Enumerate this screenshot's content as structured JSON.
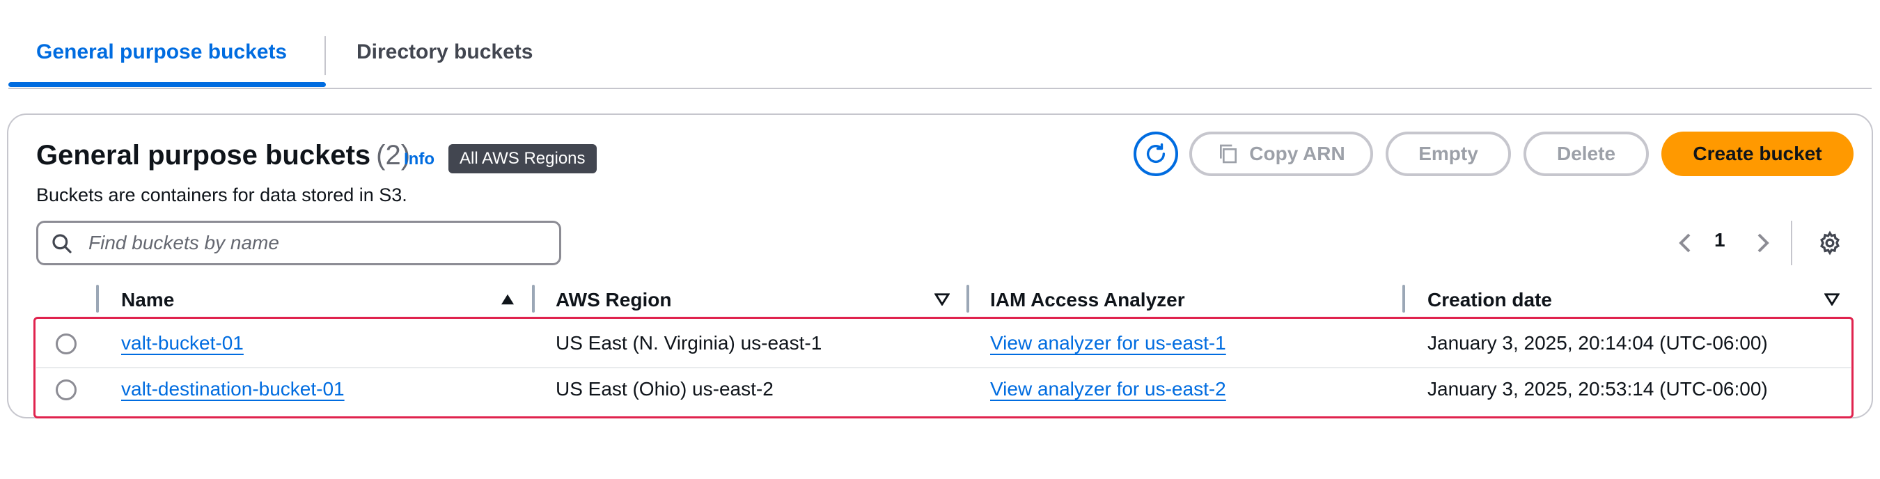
{
  "tabs": [
    {
      "label": "General purpose buckets",
      "active": true
    },
    {
      "label": "Directory buckets",
      "active": false
    }
  ],
  "header": {
    "title": "General purpose buckets",
    "count": "(2)",
    "info": "Info",
    "region_badge": "All AWS Regions",
    "description": "Buckets are containers for data stored in S3."
  },
  "actions": {
    "refresh_icon": "refresh-icon",
    "copy_arn": "Copy ARN",
    "empty": "Empty",
    "delete": "Delete",
    "create": "Create bucket"
  },
  "search": {
    "placeholder": "Find buckets by name",
    "value": ""
  },
  "pagination": {
    "current_page": "1"
  },
  "table": {
    "columns": [
      "Name",
      "AWS Region",
      "IAM Access Analyzer",
      "Creation date"
    ],
    "rows": [
      {
        "name": "valt-bucket-01",
        "region": "US East (N. Virginia) us-east-1",
        "analyzer": "View analyzer for us-east-1",
        "created": "January 3, 2025, 20:14:04 (UTC-06:00)"
      },
      {
        "name": "valt-destination-bucket-01",
        "region": "US East (Ohio) us-east-2",
        "analyzer": "View analyzer for us-east-2",
        "created": "January 3, 2025, 20:53:14 (UTC-06:00)"
      }
    ]
  },
  "colors": {
    "accent": "#006ce0",
    "primary_button": "#ff9900",
    "highlight": "#e0234e"
  }
}
